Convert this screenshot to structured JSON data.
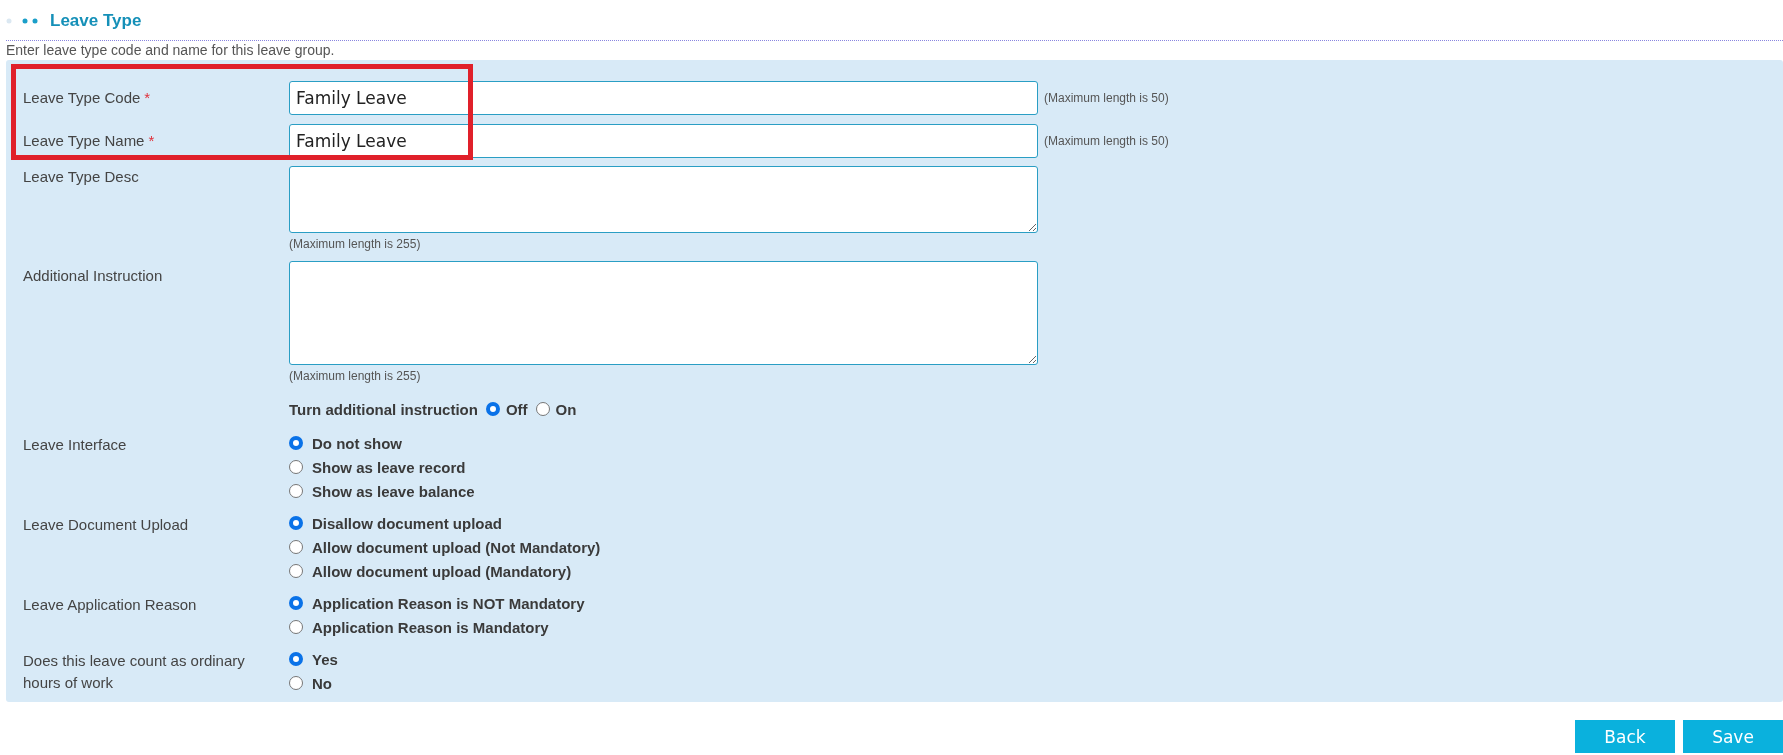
{
  "section": {
    "title": "Leave Type",
    "intro": "Enter leave type code and name for this leave group."
  },
  "text_fields": [
    {
      "label": "Leave Type Code",
      "required": true,
      "required_mark": "*",
      "value": "Family Leave",
      "hint": "(Maximum length is 50)"
    },
    {
      "label": "Leave Type Name",
      "required": true,
      "required_mark": "*",
      "value": "Family Leave",
      "hint": "(Maximum length is 50)"
    }
  ],
  "highlight_frame": true,
  "text_areas": [
    {
      "label": "Leave Type Desc",
      "hint": "(Maximum length is 255)"
    },
    {
      "label": "Additional Instruction",
      "hint": "(Maximum length is 255)"
    }
  ],
  "instruction_toggle": {
    "label": "Turn additional instruction",
    "options": [
      {
        "label": "Off",
        "selected": true
      },
      {
        "label": "On",
        "selected": false
      }
    ]
  },
  "radio_groups": [
    {
      "label": "Leave Interface",
      "options": [
        {
          "label": "Do not show",
          "selected": true
        },
        {
          "label": "Show as leave record",
          "selected": false
        },
        {
          "label": "Show as leave balance",
          "selected": false
        }
      ]
    },
    {
      "label": "Leave Document Upload",
      "options": [
        {
          "label": "Disallow document upload",
          "selected": true
        },
        {
          "label": "Allow document upload (Not Mandatory)",
          "selected": false
        },
        {
          "label": "Allow document upload (Mandatory)",
          "selected": false
        }
      ]
    },
    {
      "label": "Leave Application Reason",
      "options": [
        {
          "label": "Application Reason is NOT Mandatory",
          "selected": true
        },
        {
          "label": "Application Reason is Mandatory",
          "selected": false
        }
      ]
    },
    {
      "label": "Does this leave count as ordinary hours of work",
      "options": [
        {
          "label": "Yes",
          "selected": true
        },
        {
          "label": "No",
          "selected": false
        }
      ]
    }
  ],
  "buttons": [
    "Back",
    "Save"
  ]
}
